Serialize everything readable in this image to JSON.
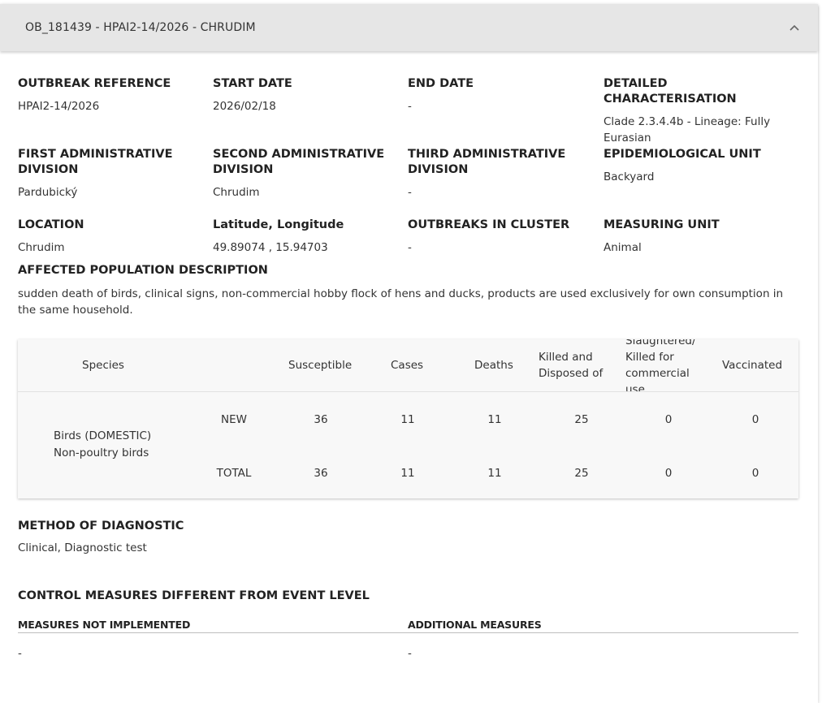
{
  "header": {
    "title": "OB_181439 - HPAI2-14/2026 - CHRUDIM"
  },
  "fields": [
    {
      "label": "OUTBREAK REFERENCE",
      "value": "HPAI2-14/2026"
    },
    {
      "label": "START DATE",
      "value": "2026/02/18"
    },
    {
      "label": "END DATE",
      "value": "-"
    },
    {
      "label": "DETAILED CHARACTERISATION",
      "value": "Clade 2.3.4.4b - Lineage: Fully Eurasian"
    },
    {
      "label": "FIRST ADMINISTRATIVE DIVISION",
      "value": "Pardubický"
    },
    {
      "label": "SECOND ADMINISTRATIVE DIVISION",
      "value": "Chrudim"
    },
    {
      "label": "THIRD ADMINISTRATIVE DIVISION",
      "value": "-"
    },
    {
      "label": "EPIDEMIOLOGICAL UNIT",
      "value": "Backyard"
    },
    {
      "label": "LOCATION",
      "value": "Chrudim"
    },
    {
      "label": "Latitude, Longitude",
      "value": "49.89074 , 15.94703"
    },
    {
      "label": "OUTBREAKS IN CLUSTER",
      "value": "-"
    },
    {
      "label": "MEASURING UNIT",
      "value": "Animal"
    }
  ],
  "affected_population": {
    "label": "AFFECTED POPULATION DESCRIPTION",
    "value": "sudden death of birds, clinical signs, non-commercial hobby flock of hens and ducks, products are used exclusively for own consumption in the same household."
  },
  "table": {
    "headers": {
      "species": "Species",
      "susceptible": "Susceptible",
      "cases": "Cases",
      "deaths": "Deaths",
      "killed": "Killed and Disposed of",
      "slaughtered": "Slaughtered/ Killed for commercial use",
      "vaccinated": "Vaccinated"
    },
    "species": {
      "line1": "Birds (DOMESTIC)",
      "line2": "Non-poultry birds"
    },
    "rows": [
      {
        "type": "NEW",
        "susceptible": "36",
        "cases": "11",
        "deaths": "11",
        "killed": "25",
        "slaughtered": "0",
        "vaccinated": "0"
      },
      {
        "type": "TOTAL",
        "susceptible": "36",
        "cases": "11",
        "deaths": "11",
        "killed": "25",
        "slaughtered": "0",
        "vaccinated": "0"
      }
    ]
  },
  "diagnostic": {
    "label": "METHOD OF DIAGNOSTIC",
    "value": "Clinical, Diagnostic test"
  },
  "control_measures": {
    "label": "CONTROL MEASURES DIFFERENT FROM EVENT LEVEL",
    "not_implemented_label": "MEASURES NOT IMPLEMENTED",
    "not_implemented_value": "-",
    "additional_label": "ADDITIONAL MEASURES",
    "additional_value": "-"
  }
}
